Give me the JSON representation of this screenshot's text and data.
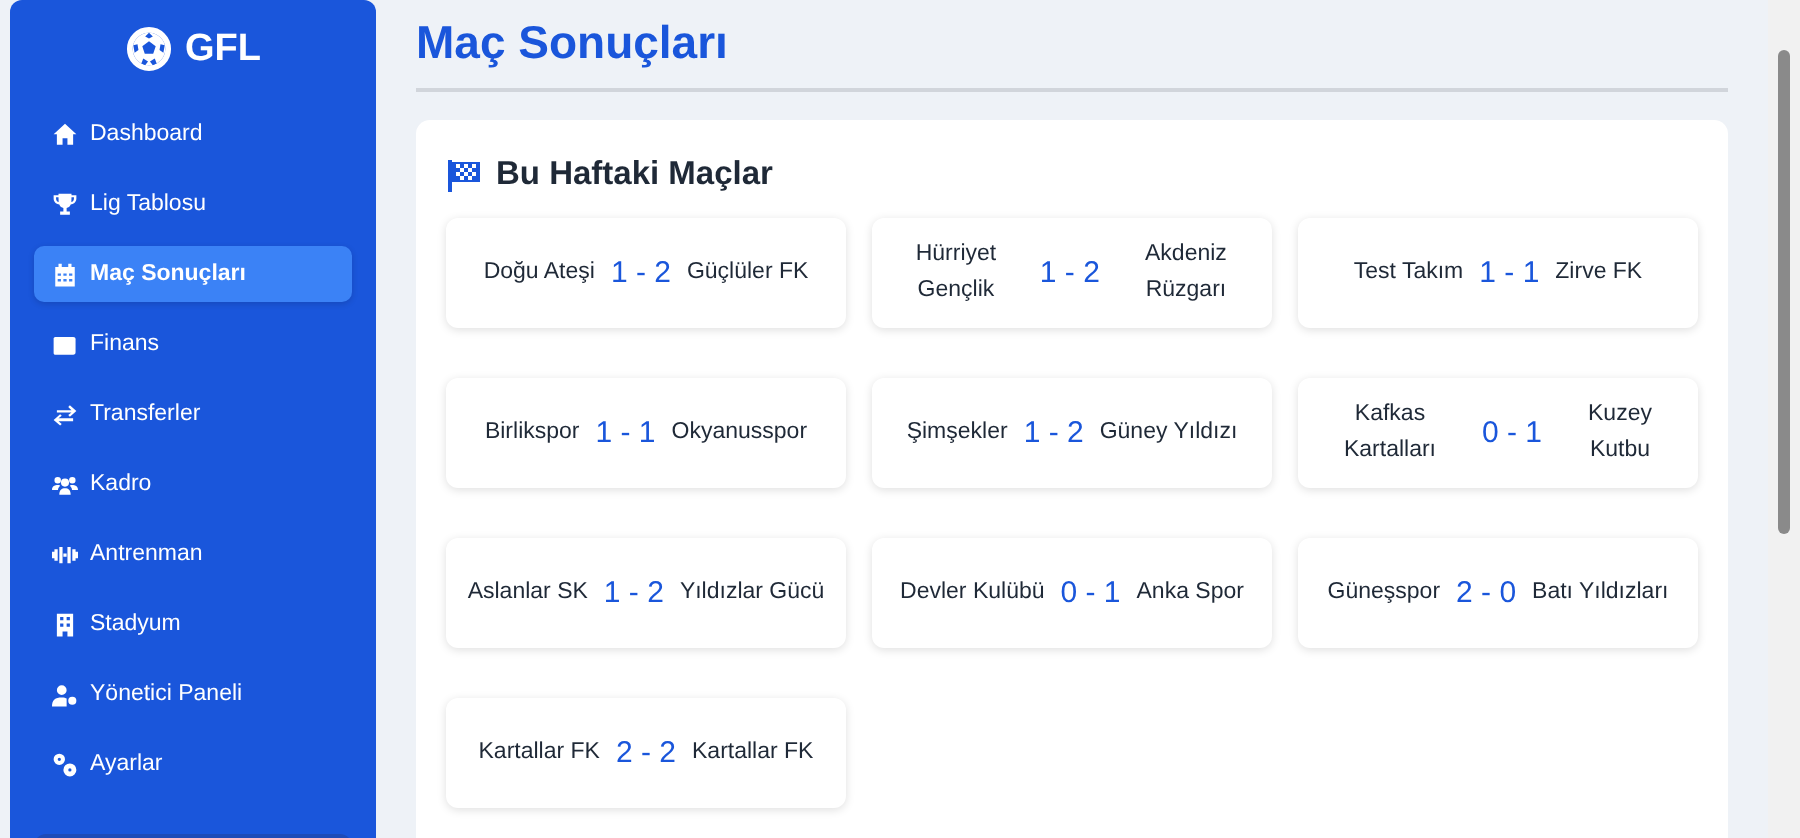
{
  "sidebar": {
    "logo": "GFL",
    "items": [
      {
        "label": "Dashboard",
        "selected": false
      },
      {
        "label": "Lig Tablosu",
        "selected": false
      },
      {
        "label": "Maç Sonuçları",
        "selected": true
      },
      {
        "label": "Finans",
        "selected": false
      },
      {
        "label": "Transferler",
        "selected": false
      },
      {
        "label": "Kadro",
        "selected": false
      },
      {
        "label": "Antrenman",
        "selected": false
      },
      {
        "label": "Stadyum",
        "selected": false
      },
      {
        "label": "Yönetici Paneli",
        "selected": false
      },
      {
        "label": "Ayarlar",
        "selected": false
      }
    ]
  },
  "page_title": "Maç Sonuçları",
  "section": {
    "title": "Bu Haftaki Maçlar",
    "matches": [
      {
        "home": "Doğu Ateşi",
        "score": "1 - 2",
        "away": "Güçlüler FK"
      },
      {
        "home": "Hürriyet Gençlik",
        "score": "1 - 2",
        "away": "Akdeniz Rüzgarı"
      },
      {
        "home": "Test Takım",
        "score": "1 - 1",
        "away": "Zirve FK"
      },
      {
        "home": "Birlikspor",
        "score": "1 - 1",
        "away": "Okyanusspor"
      },
      {
        "home": "Şimşekler",
        "score": "1 - 2",
        "away": "Güney Yıldızı"
      },
      {
        "home": "Kafkas Kartalları",
        "score": "0 - 1",
        "away": "Kuzey Kutbu"
      },
      {
        "home": "Aslanlar SK",
        "score": "1 - 2",
        "away": "Yıldızlar Gücü"
      },
      {
        "home": "Devler Kulübü",
        "score": "0 - 1",
        "away": "Anka Spor"
      },
      {
        "home": "Güneşspor",
        "score": "2 - 0",
        "away": "Batı Yıldızları"
      },
      {
        "home": "Kartallar FK",
        "score": "2 - 2",
        "away": "Kartallar FK"
      }
    ]
  }
}
